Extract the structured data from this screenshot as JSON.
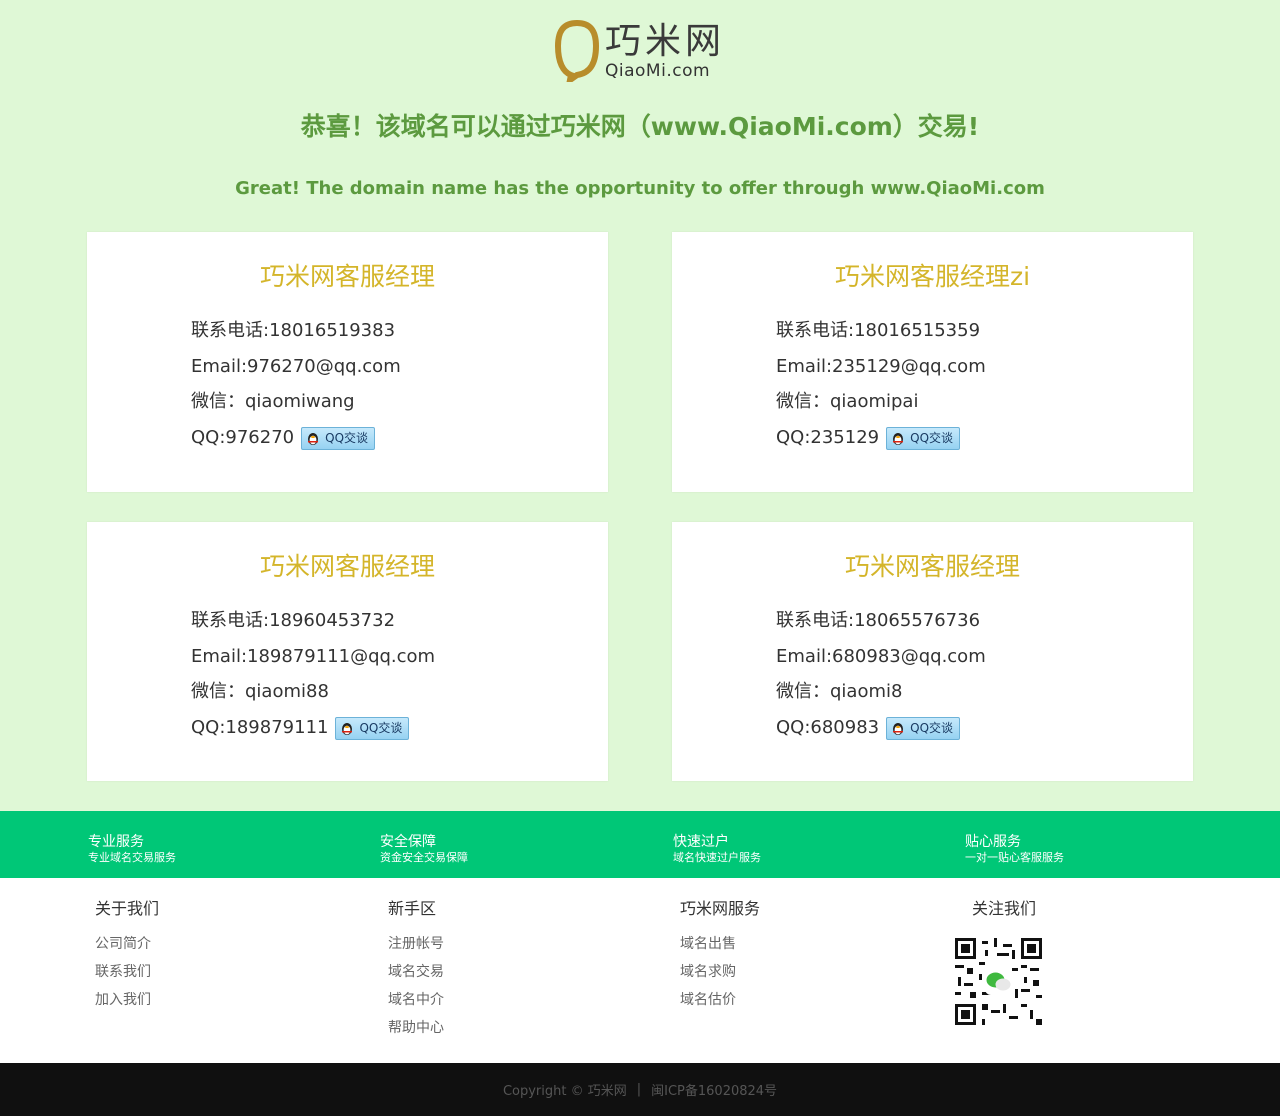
{
  "logo": {
    "cn": "巧米网",
    "en": "QiaoMi.com"
  },
  "headline": {
    "cn": "恭喜！该域名可以通过巧米网（www.QiaoMi.com）交易!",
    "en": "Great! The domain name has the opportunity to offer through www.QiaoMi.com"
  },
  "cards": [
    {
      "title": "巧米网客服经理",
      "phone": "联系电话:18016519383",
      "email": "Email:976270@qq.com",
      "wechat": "微信：qiaomiwang",
      "qq": "QQ:976270",
      "qq_button": "QQ交谈"
    },
    {
      "title": "巧米网客服经理zi",
      "phone": "联系电话:18016515359",
      "email": "Email:235129@qq.com",
      "wechat": "微信：qiaomipai",
      "qq": "QQ:235129",
      "qq_button": "QQ交谈"
    },
    {
      "title": "巧米网客服经理",
      "phone": "联系电话:18960453732",
      "email": "Email:189879111@qq.com",
      "wechat": "微信：qiaomi88",
      "qq": "QQ:189879111",
      "qq_button": "QQ交谈"
    },
    {
      "title": "巧米网客服经理",
      "phone": "联系电话:18065576736",
      "email": "Email:680983@qq.com",
      "wechat": "微信：qiaomi8",
      "qq": "QQ:680983",
      "qq_button": "QQ交谈"
    }
  ],
  "features": [
    {
      "title": "专业服务",
      "sub": "专业域名交易服务"
    },
    {
      "title": "安全保障",
      "sub": "资金安全交易保障"
    },
    {
      "title": "快速过户",
      "sub": "域名快速过户服务"
    },
    {
      "title": "贴心服务",
      "sub": "一对一贴心客服服务"
    }
  ],
  "columns": [
    {
      "title": "关于我们",
      "links": [
        "公司简介",
        "联系我们",
        "加入我们"
      ]
    },
    {
      "title": "新手区",
      "links": [
        "注册帐号",
        "域名交易",
        "域名中介"
      ]
    },
    {
      "title": "巧米网服务",
      "links": [
        "域名出售",
        "域名求购",
        "域名估价"
      ]
    },
    {
      "title": "关注我们",
      "links": []
    }
  ],
  "extra_link": "帮助中心",
  "footer": {
    "copyright": "Copyright © 巧米网",
    "separator": "|",
    "icp": "闽ICP备16020824号"
  },
  "colors": {
    "bg": "#dff8d6",
    "accent": "#5c9a3f",
    "title": "#d4b52a",
    "band": "#00c777",
    "footer": "#101010"
  }
}
